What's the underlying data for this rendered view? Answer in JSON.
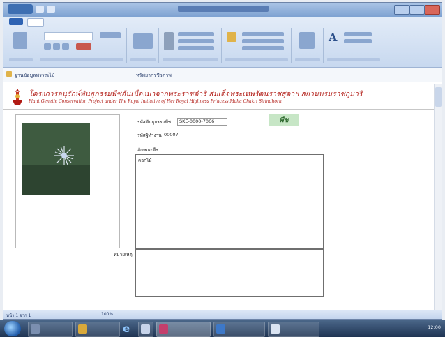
{
  "nav": {
    "path": "ฐานข้อมูลพรรณไม้",
    "link": "ทรัพยากรชีวภาพ"
  },
  "form": {
    "banner_title": "โครงการอนุรักษ์พันธุกรรมพืชอันเนื่องมาจากพระราชดำริ สมเด็จพระเทพรัตนราชสุดาฯ สยามบรมราชกุมารี",
    "banner_subtitle": "Plant Genetic Conservation Project under The Royal Initiative of Her Royal Highness Princess Maha Chakri Sirindhorn",
    "badge": "พืช",
    "fields": {
      "code_label": "รหัสพันธุกรรมพืช",
      "code_value": "SKE-0000-7066",
      "id_label": "รหัสผู้ทำงาน",
      "id_value": "00007",
      "desc_label": "ลักษณะพืช",
      "desc_value": "ดอกไม้",
      "note_label": "หมายเหตุ"
    }
  },
  "statusbar": {
    "left": "หน้า 1 จาก 1",
    "mid": "100%"
  },
  "taskbar": {
    "clock": "12:00"
  }
}
